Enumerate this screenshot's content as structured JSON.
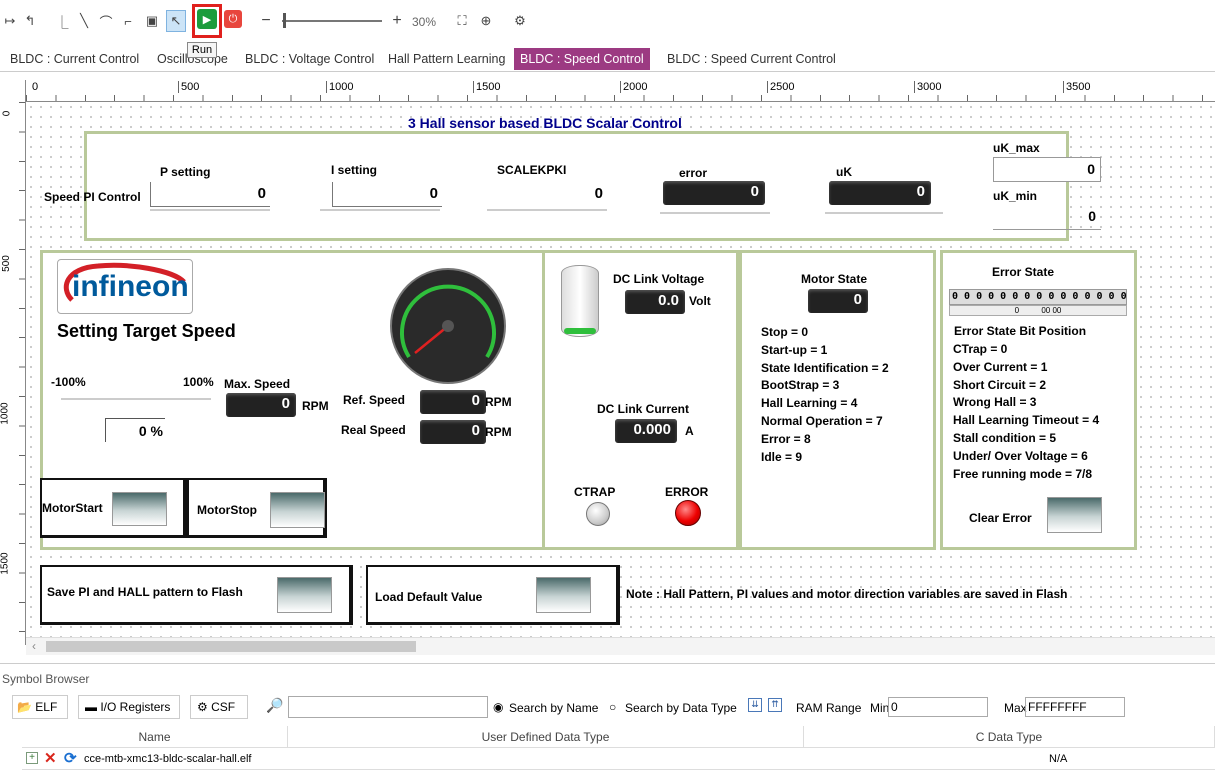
{
  "toolbar": {
    "zoom": "30%",
    "tooltip": "Run"
  },
  "tabs": [
    "BLDC : Current  Control",
    "Oscilloscope",
    "BLDC : Voltage Control",
    "Hall Pattern Learning",
    "BLDC : Speed Control",
    "BLDC : Speed Current Control"
  ],
  "ruler": {
    "top": [
      "0",
      "500",
      "1000",
      "1500",
      "2000",
      "2500",
      "3000",
      "3500"
    ],
    "left": [
      "0",
      "500",
      "1000",
      "1500"
    ]
  },
  "canvas": {
    "title": "3 Hall sensor based BLDC Scalar Control",
    "speed_pi": {
      "label": "Speed PI Control",
      "p_label": "P setting",
      "p_value": "0",
      "i_label": "I setting",
      "i_value": "0",
      "scale_label": "SCALEKPKI",
      "scale_value": "0",
      "error_label": "error",
      "error_value": "0",
      "uk_label": "uK",
      "uk_value": "0",
      "ukmax_label": "uK_max",
      "ukmax_value": "0",
      "ukmin_label": "uK_min",
      "ukmin_value": "0"
    },
    "logo": "infineon",
    "target": {
      "heading": "Setting Target Speed",
      "min": "-100%",
      "max": "100%",
      "max_speed_label": "Max. Speed",
      "max_speed_value": "0",
      "rpm": "RPM",
      "percent_value": "0 %",
      "ref_label": "Ref. Speed",
      "ref_value": "0",
      "ref_unit": "RPM",
      "real_label": "Real Speed",
      "real_value": "0",
      "real_unit": "RPM"
    },
    "motor_start": "MotorStart",
    "motor_stop": "MotorStop",
    "dc": {
      "voltage_label": "DC Link Voltage",
      "voltage_value": "0.0",
      "voltage_unit": "Volt",
      "current_label": "DC Link Current",
      "current_value": "0.000",
      "current_unit": "A",
      "ctrap": "CTRAP",
      "error": "ERROR"
    },
    "motor_state": {
      "title": "Motor State",
      "value": "0",
      "lines": [
        "Stop = 0",
        "Start-up = 1",
        "State Identification = 2",
        "BootStrap = 3",
        "Hall Learning = 4",
        "Normal Operation = 7",
        "Error = 8",
        "Idle = 9"
      ]
    },
    "error_state": {
      "title": "Error State",
      "bits": "0 0 0 0  0 0 0 0  0 0 0 0  0 0 0 0",
      "sub": "0          00 00",
      "bitpos_title": "Error State Bit Position",
      "lines": [
        "CTrap = 0",
        "Over Current = 1",
        "Short Circuit = 2",
        "Wrong Hall = 3",
        "Hall Learning Timeout = 4",
        "Stall condition = 5",
        "Under/ Over Voltage = 6",
        "Free running mode = 7/8"
      ],
      "clear": "Clear Error"
    },
    "save": "Save PI and HALL pattern to Flash",
    "load": "Load Default Value",
    "note": "Note : Hall Pattern,  PI values and motor direction variables are saved in Flash"
  },
  "symbol_browser": {
    "title": "Symbol Browser",
    "elf": "ELF",
    "io": "I/O Registers",
    "csf": "CSF",
    "search_name": "Search by Name",
    "search_type": "Search by Data Type",
    "ram_range": "RAM Range",
    "min_label": "Min",
    "min_value": "0",
    "max_label": "Max",
    "max_value": "FFFFFFFF",
    "col_name": "Name",
    "col_udt": "User Defined Data Type",
    "col_cdt": "C Data Type",
    "row_name": "cce-mtb-xmc13-bldc-scalar-hall.elf",
    "row_cdt": "N/A"
  }
}
